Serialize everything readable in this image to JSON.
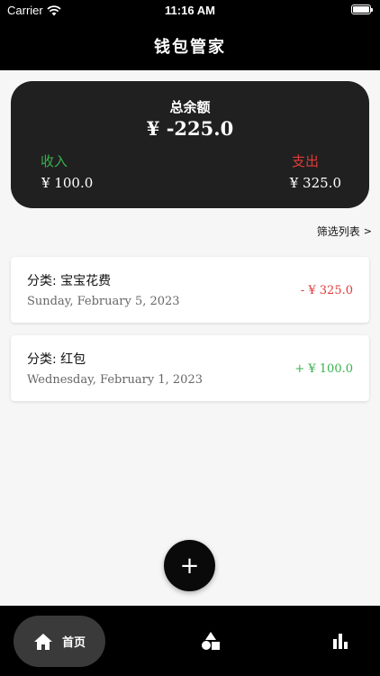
{
  "status_bar": {
    "carrier": "Carrier",
    "time": "11:16 AM"
  },
  "nav": {
    "title": "钱包管家"
  },
  "summary": {
    "title": "总余额",
    "balance": "¥  -225.0",
    "income_label": "收入",
    "income_value": "¥ 100.0",
    "expense_label": "支出",
    "expense_value": "¥ 325.0"
  },
  "filter": {
    "label": "筛选列表",
    "chevron": ">"
  },
  "transactions": [
    {
      "category": "分类: 宝宝花费",
      "date": "Sunday, February 5, 2023",
      "amount": "- ¥ 325.0",
      "color": "#e03a3a"
    },
    {
      "category": "分类: 红包",
      "date": "Wednesday, February 1, 2023",
      "amount": "+ ¥ 100.0",
      "color": "#37b24d"
    }
  ],
  "fab": {
    "symbol": "+"
  },
  "tabbar": {
    "home_label": "首页",
    "icons": [
      "home-icon",
      "shapes-icon",
      "bar-chart-icon"
    ]
  },
  "colors": {
    "income": "#37b24d",
    "expense": "#e03a3a",
    "card_dark": "#202020"
  }
}
